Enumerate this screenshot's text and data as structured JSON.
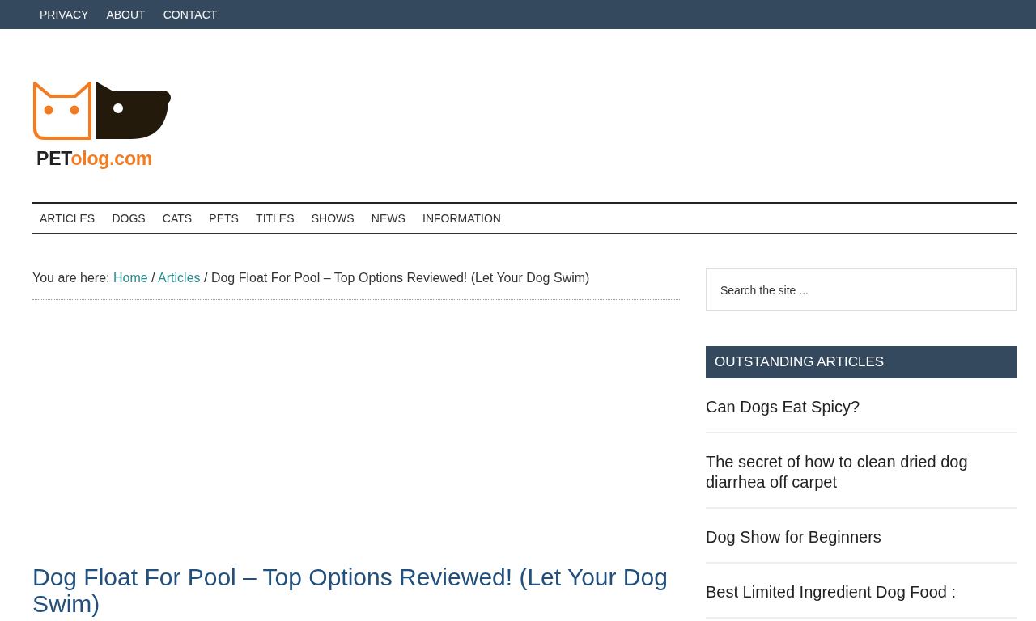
{
  "top_bar": {
    "links": [
      "PRIVACY",
      "ABOUT",
      "CONTACT"
    ]
  },
  "logo": {
    "text_dark": "PET",
    "text_accent": "olog.com"
  },
  "main_nav": {
    "items": [
      "ARTICLES",
      "DOGS",
      "CATS",
      "PETS",
      "TITLES",
      "SHOWS",
      "NEWS",
      "INFORMATION"
    ]
  },
  "breadcrumb": {
    "prefix": "You are here:",
    "separator": "/",
    "links": [
      "Home",
      "Articles"
    ],
    "current": "Dog Float For Pool – Top Options Reviewed! (Let Your Dog Swim)"
  },
  "article": {
    "title": "Dog Float For Pool – Top Options Reviewed! (Let Your Dog Swim)"
  },
  "sidebar": {
    "search": {
      "placeholder": "Search the site ..."
    },
    "widget": {
      "title": "OUTSTANDING ARTICLES",
      "items": [
        "Can Dogs Eat Spicy?",
        "The secret of how to clean dried dog diarrhea off carpet",
        "Dog Show for Beginners",
        "Best Limited Ingredient Dog Food :"
      ]
    }
  }
}
